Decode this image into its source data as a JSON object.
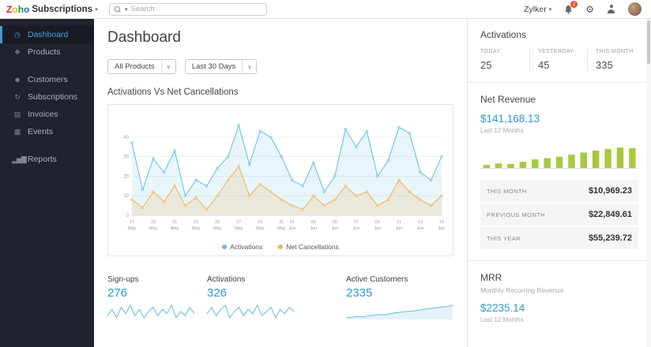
{
  "colors": {
    "accent_blue": "#2f9ad3",
    "sidebar_active_blue": "#4ba0da",
    "badge_red": "#e8503a",
    "line_blue": "#62bde4",
    "line_orange": "#f0b050",
    "bar_green": "#a8c93f"
  },
  "topbar": {
    "logo_letters": [
      {
        "ch": "Z",
        "color": "#e42527"
      },
      {
        "ch": "o",
        "color": "#f9b21d"
      },
      {
        "ch": "h",
        "color": "#089949"
      },
      {
        "ch": "o",
        "color": "#226db4"
      }
    ],
    "app_name": "Subscriptions",
    "caret": "▾",
    "search_placeholder": "Search",
    "search_caret": "▾",
    "user_menu_label": "Zylker",
    "notification_count": "2",
    "gear_icon": "⚙"
  },
  "sidebar": {
    "items": [
      {
        "label": "Dashboard",
        "icon": "◷",
        "active": true
      },
      {
        "label": "Products",
        "icon": "❖",
        "active": false
      },
      {
        "label": "Customers",
        "icon": "☻",
        "active": false
      },
      {
        "label": "Subscriptions",
        "icon": "↻",
        "active": false
      },
      {
        "label": "Invoices",
        "icon": "▤",
        "active": false
      },
      {
        "label": "Events",
        "icon": "▦",
        "active": false
      },
      {
        "label": "Reports",
        "icon": "▂▅▇",
        "active": false
      }
    ]
  },
  "main": {
    "title": "Dashboard",
    "filters": {
      "products": "All Products",
      "range": "Last 30 Days",
      "chevron": "∨"
    },
    "chart_title": "Activations Vs Net Cancellations",
    "legend": [
      {
        "label": "Activations"
      },
      {
        "label": "Net Cancellations"
      }
    ],
    "stats": [
      {
        "label": "Sign-ups",
        "value": "276"
      },
      {
        "label": "Activations",
        "value": "326"
      },
      {
        "label": "Active Customers",
        "value": "2335"
      }
    ]
  },
  "right_panel": {
    "activations": {
      "title": "Activations",
      "cols": [
        {
          "label": "TODAY",
          "value": "25"
        },
        {
          "label": "YESTERDAY",
          "value": "45"
        },
        {
          "label": "THIS MONTH",
          "value": "335"
        }
      ]
    },
    "net_revenue": {
      "title": "Net Revenue",
      "amount": "$141,168.13",
      "period": "Last 12 Months",
      "rows": [
        {
          "label": "THIS MONTH",
          "value": "$10,969.23"
        },
        {
          "label": "PREVIOUS MONTH",
          "value": "$22,849.61"
        },
        {
          "label": "THIS YEAR",
          "value": "$55,239.72"
        }
      ]
    },
    "mrr": {
      "title": "MRR",
      "subtitle": "Monthly Recurring Revenue",
      "amount": "$2235.14",
      "period": "Last 12 Months"
    }
  },
  "chart_data": [
    {
      "name": "main",
      "type": "line",
      "title": "Activations Vs Net Cancellations",
      "x": [
        "May 17",
        "May 18",
        "May 19",
        "May 20",
        "May 21",
        "May 22",
        "May 23",
        "May 24",
        "May 25",
        "May 26",
        "May 27",
        "May 28",
        "May 29",
        "May 30",
        "May 31",
        "Jun 01",
        "Jun 02",
        "Jun 03",
        "Jun 04",
        "Jun 05",
        "Jun 06",
        "Jun 07",
        "Jun 08",
        "Jun 09",
        "Jun 10",
        "Jun 11",
        "Jun 12",
        "Jun 13",
        "Jun 14",
        "Jun 15"
      ],
      "ticks": [
        {
          "i": 0,
          "d": "17",
          "m": "May"
        },
        {
          "i": 2,
          "d": "19",
          "m": "May"
        },
        {
          "i": 4,
          "d": "21",
          "m": "May"
        },
        {
          "i": 6,
          "d": "23",
          "m": "May"
        },
        {
          "i": 8,
          "d": "25",
          "m": "May"
        },
        {
          "i": 10,
          "d": "27",
          "m": "May"
        },
        {
          "i": 12,
          "d": "29",
          "m": "May"
        },
        {
          "i": 14,
          "d": "31",
          "m": "May"
        },
        {
          "i": 15,
          "d": "01",
          "m": "Jun"
        },
        {
          "i": 17,
          "d": "03",
          "m": "Jun"
        },
        {
          "i": 19,
          "d": "05",
          "m": "Jun"
        },
        {
          "i": 21,
          "d": "07",
          "m": "Jun"
        },
        {
          "i": 23,
          "d": "09",
          "m": "Jun"
        },
        {
          "i": 25,
          "d": "11",
          "m": "Jun"
        },
        {
          "i": 27,
          "d": "13",
          "m": "Jun"
        },
        {
          "i": 29,
          "d": "15",
          "m": "Jun"
        }
      ],
      "ylim": [
        0,
        50
      ],
      "yticks": [
        0,
        10,
        20,
        30,
        40
      ],
      "legend_position": "bottom",
      "series": [
        {
          "name": "Activations",
          "color": "#62bde4",
          "fill": "rgba(98,189,228,0.15)",
          "values": [
            37,
            13,
            29,
            22,
            33,
            10,
            18,
            15,
            24,
            30,
            46,
            26,
            43,
            40,
            30,
            18,
            15,
            27,
            12,
            20,
            44,
            35,
            43,
            20,
            28,
            45,
            42,
            22,
            18,
            30
          ]
        },
        {
          "name": "Net Cancellations",
          "color": "#f0b050",
          "fill": "rgba(240,176,80,0.18)",
          "values": [
            8,
            4,
            12,
            7,
            15,
            5,
            9,
            3,
            10,
            18,
            25,
            10,
            16,
            12,
            8,
            5,
            3,
            10,
            5,
            8,
            15,
            10,
            12,
            5,
            8,
            18,
            12,
            8,
            5,
            10
          ]
        }
      ]
    },
    {
      "name": "spark_signups",
      "type": "line",
      "color": "#62bde4",
      "values": [
        4,
        7,
        3,
        8,
        5,
        9,
        4,
        7,
        3,
        6,
        8,
        4,
        7,
        5,
        9,
        3,
        6,
        4,
        8,
        5
      ]
    },
    {
      "name": "spark_activations",
      "type": "line",
      "color": "#62bde4",
      "values": [
        5,
        8,
        4,
        7,
        9,
        3,
        6,
        8,
        4,
        7,
        5,
        9,
        4,
        6,
        8,
        3,
        7,
        5,
        8,
        6
      ]
    },
    {
      "name": "spark_customers",
      "type": "area",
      "color": "#62bde4",
      "fill": "rgba(98,189,228,0.18)",
      "values": [
        3,
        3.1,
        3.3,
        3.2,
        3.5,
        3.6,
        3.8,
        3.7,
        4.0,
        4.2,
        4.3,
        4.5,
        4.6,
        4.8,
        5.0,
        5.1,
        5.3,
        5.5,
        5.6,
        5.9
      ]
    },
    {
      "name": "revenue_bars",
      "type": "bar",
      "color": "#a8c93f",
      "values": [
        1.5,
        2.2,
        2.0,
        3.0,
        4.2,
        4.8,
        5.5,
        6.5,
        7.5,
        8.5,
        9.2,
        10,
        9.6
      ]
    }
  ]
}
